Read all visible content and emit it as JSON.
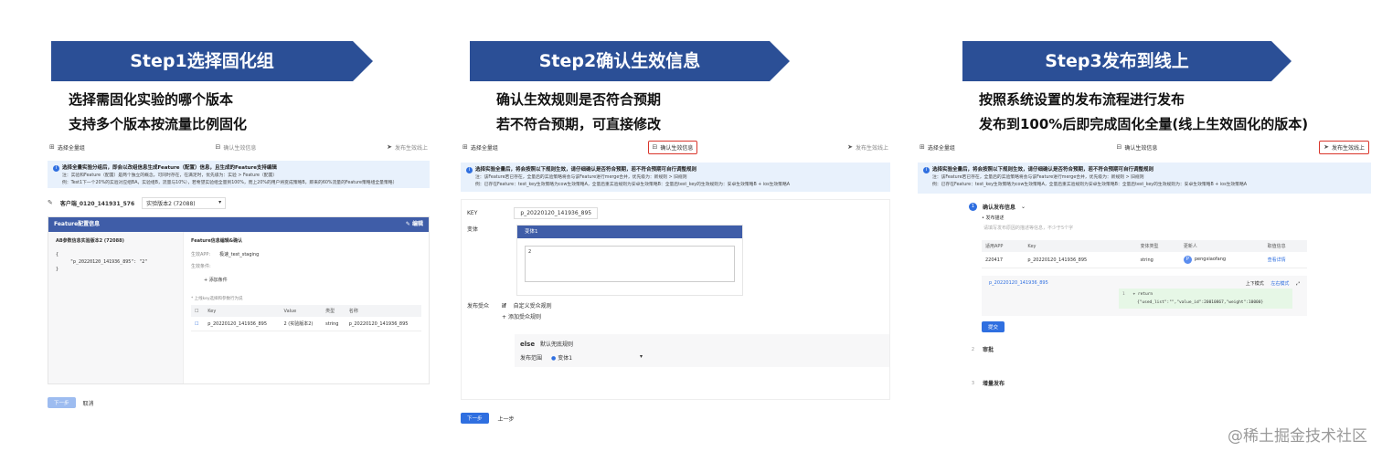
{
  "steps": [
    {
      "banner": "Step1选择固化组",
      "desc1": "选择需固化实验的哪个版本",
      "desc2": "支持多个版本按流量比例固化"
    },
    {
      "banner": "Step2确认生效信息",
      "desc1": "确认生效规则是否符合预期",
      "desc2": "若不符合预期，可直接修改"
    },
    {
      "banner": "Step3发布到线上",
      "desc1": "按照系统设置的发布流程进行发布",
      "desc2": "发布到100%后即完成固化全量(线上生效固化的版本)"
    }
  ],
  "panel1": {
    "tab1": "选择全量组",
    "tab2": "确认生效信息",
    "tab3": "发布生效线上",
    "info_title": "选择全量实验分组后，即会以改组信息生成Feature（配置）信息，且生成的Feature支持编辑",
    "info_line1": "注：实验和Feature（配置）是两个独立的概念，可同时存在，在满足时，优先级为：实验 > Feature（配置）",
    "info_line2": "例：Test1下一个20%的实验对应组BA，实验组B，流量与10%），若希望实验组全量到100%，而上20%的用户将变成策略B，即来的60%流量的Feature策略组全量策略）",
    "group_label": "客户端_0120_141931_576",
    "group_select": "实验版本2 (72088)",
    "card_title": "Feature配置信息",
    "card_action": "编辑",
    "left_title": "AB参数信息实验版本2 (72088)",
    "left_code1": "{",
    "left_code2": "\"p_20220120_141936_895\": \"2\"",
    "left_code3": "}",
    "right_title": "Feature信息编辑&确认",
    "app_label": "生效APP:",
    "app_value": "极速_test_staging",
    "cond_label": "生效条件:",
    "add_cond": "添加条件",
    "key_hint": "* 上线key选择和参数行为说",
    "col_key": "Key",
    "col_value": "Value",
    "col_type": "类型",
    "col_name": "名称",
    "row_key": "p_20220120_141936_895",
    "row_value": "2 (实验版本2)",
    "row_type": "string",
    "row_name": "p_20220120_141936_895",
    "btn_next": "下一步",
    "btn_cancel": "取消"
  },
  "panel2": {
    "tab1": "选择全量组",
    "tab2": "确认生效信息",
    "tab3": "发布生效线上",
    "info_title": "选择实验全量后，将会按照以下规则生效，请仔细确认是否符合预期，若不符合预期可自行调整规则",
    "info_line1": "注：该Feature若已存在，全量后的实验策略将会与该Feature进行merge合并，优先级为：新规则 > 旧规则",
    "info_line2": "例：已存在Feature：test_key生效策略为cow生效策略A，全量后重实验规则为安卓生效策略B：全量后test_key的生效规则为：安卓生效策略B + ios生效策略A",
    "key_label": "KEY",
    "key_value": "p_20220120_141936_895",
    "var_label": "变体",
    "var_head": "变体1",
    "var_value": "2",
    "pub_label": "发布受众",
    "pub_if": "if",
    "pub_rule": "自定义受众规则",
    "pub_add": "添加受众规则",
    "else_label": "else",
    "else_rule": "默认兜底规则",
    "range_label": "发布范围",
    "range_value": "变体1",
    "btn_next": "下一步",
    "btn_prev": "上一步"
  },
  "panel3": {
    "tab1": "选择全量组",
    "tab2": "确认生效信息",
    "tab3": "发布生效线上",
    "info_title": "选择实验全量后，将会按照以下规则生效，请仔细确认是否符合预期，若不符合预期可自行调整规则",
    "info_line1": "注：该Feature若已存在，全量后的实验策略将会与该Feature进行merge合并，优先级为：新规则 > 旧规则",
    "info_line2": "例：已存在Feature：test_key生效策略为cow生效策略A，全量后重实验规则为安卓生效策略B：全量后test_key的生效规则为：安卓生效策略B + ios生效策略A",
    "s1_num": "1",
    "s1_title": "确认发布信息",
    "desc_label": "• 发布描述",
    "desc_placeholder": "请填写发布原因的描述等信息，不少于5个字",
    "col_app": "适用APP",
    "col_key": "Key",
    "col_type": "变体类型",
    "col_user": "更新人",
    "col_info": "取值信息",
    "row_app": "220417",
    "row_key": "p_20220120_141936_895",
    "row_type": "string",
    "row_user": "pengxiaofang",
    "row_avatar": "P",
    "row_link": "查看详情",
    "diff_key": "p_20220120_141936_895",
    "diff_mode1": "上下模式",
    "diff_mode2": "左右模式",
    "code_ln1": "1",
    "code_ln2": "",
    "code_1": "+ return",
    "code_2": "{\"used_list\":\"\",\"value_id\":20010867,\"weight\":10000}",
    "btn_submit": "提交",
    "s2_num": "2",
    "s2_title": "审批",
    "s3_num": "3",
    "s3_title": "增量发布"
  },
  "watermark": "@稀土掘金技术社区",
  "colors": {
    "banner": "#2b4f96",
    "accent": "#2f6fe0",
    "highlight": "#d9352b",
    "info_bg": "#e8f1fc"
  }
}
